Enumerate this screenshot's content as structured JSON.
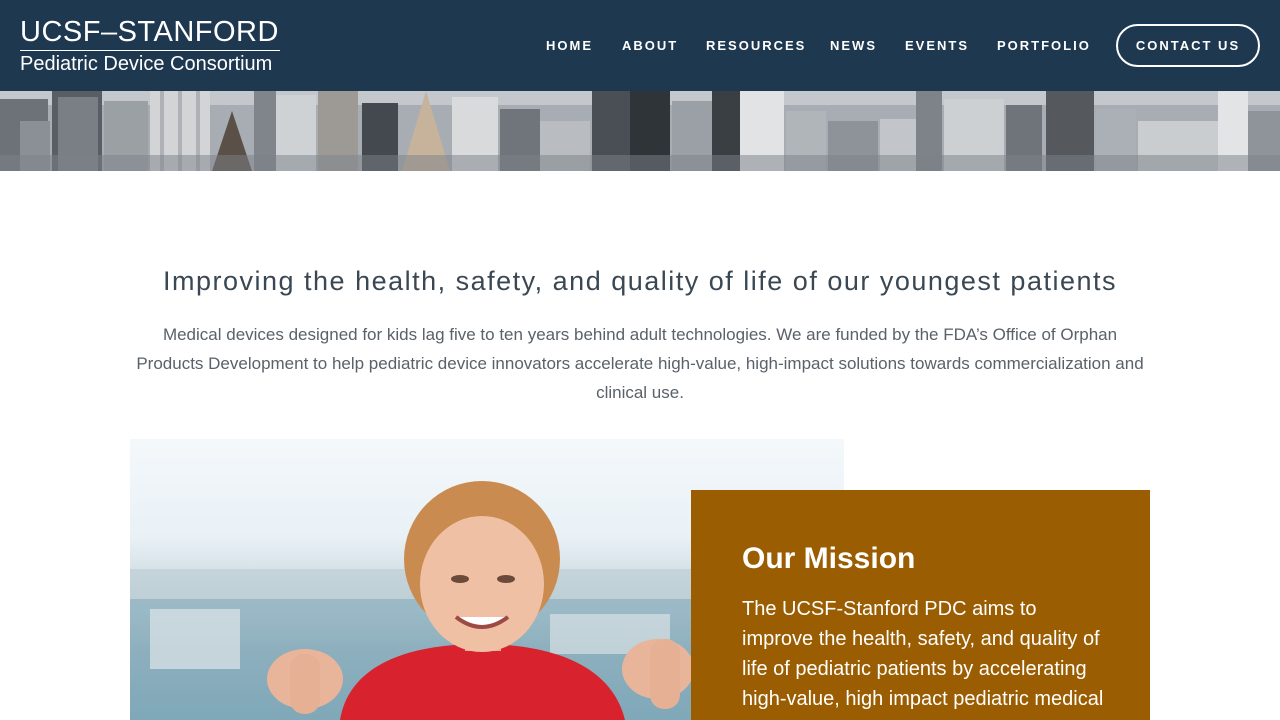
{
  "header": {
    "logo": {
      "line1": "UCSF–STANFORD",
      "line2": "Pediatric Device Consortium"
    },
    "nav": {
      "home": "HOME",
      "about": "ABOUT",
      "resources": "RESOURCES",
      "news": "NEWS",
      "events": "EVENTS",
      "portfolio": "PORTFOLIO"
    },
    "contact_label": "CONTACT US"
  },
  "intro": {
    "headline": "Improving the health, safety, and quality of life of our youngest patients",
    "body": "Medical devices designed for kids lag five to ten years behind adult technologies. We are funded by the FDA’s Office of Orphan Products Development to help pediatric device innovators accelerate high-value, high-impact solutions towards commercialization and clinical use."
  },
  "mission": {
    "title": "Our Mission",
    "body": "The UCSF-Stanford PDC aims to improve the health, safety, and quality of life of pediatric patients by accelerating high-value, high impact pediatric medical devices toward clinical use"
  },
  "colors": {
    "header_bg": "#1e3850",
    "mission_bg": "#9a5d02",
    "text_dark": "#3b4853"
  },
  "images": {
    "banner": "city-skyline-photo",
    "photo": "smiling-child-flexing-photo"
  }
}
